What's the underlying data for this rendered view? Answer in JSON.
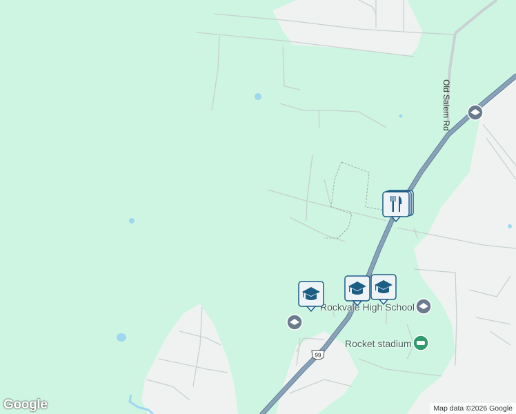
{
  "map": {
    "road_labels": {
      "old_salem": "Old Salem Rd"
    },
    "poi_labels": {
      "rockvale_hs": "Rockvale High School",
      "rocket_stadium": "Rocket stadium"
    },
    "route_shield": "99",
    "pins": {
      "restaurant": "restaurant-icon",
      "school_a": "graduation-cap-icon",
      "school_b": "graduation-cap-icon",
      "school_c": "graduation-cap-icon"
    },
    "colors": {
      "land": "#cdf5e1",
      "developed": "#f1f3f4",
      "highway": "#8aa2b8",
      "water": "#9fd6f0",
      "pin": "#1c5d86"
    }
  },
  "branding": {
    "logo": "Google",
    "attribution": "Map data ©2026 Google"
  }
}
